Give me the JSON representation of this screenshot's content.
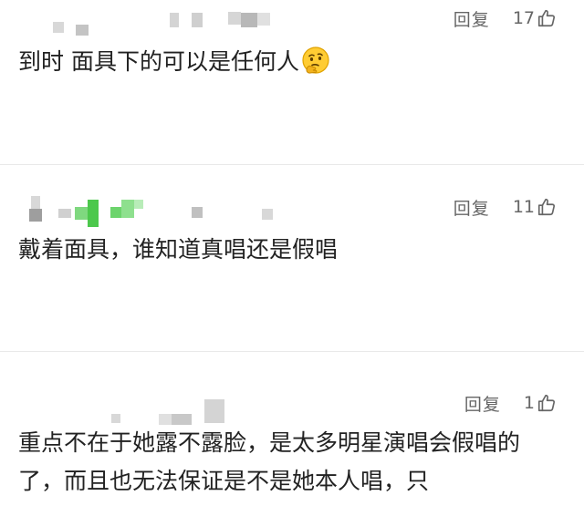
{
  "comments": [
    {
      "reply_label": "回复",
      "like_count": "17",
      "text": "到时 面具下的可以是任何人",
      "emoji": "thinking-face-icon"
    },
    {
      "reply_label": "回复",
      "like_count": "11",
      "text": "戴着面具，谁知道真唱还是假唱"
    },
    {
      "reply_label": "回复",
      "like_count": "1",
      "text": "重点不在于她露不露脸，是太多明星演唱会假唱的了，而且也无法保证是不是她本人唱，只"
    }
  ],
  "colors": {
    "text": "#222222",
    "meta": "#666666",
    "divider": "#e9e9e9",
    "blur_gray": "#cfcfcf",
    "blur_green": "#5fd35f",
    "emoji_yellow": "#ffcc33"
  },
  "icons": {
    "like": "thumbs-up-icon",
    "avatar_blur": "blurred-username"
  }
}
